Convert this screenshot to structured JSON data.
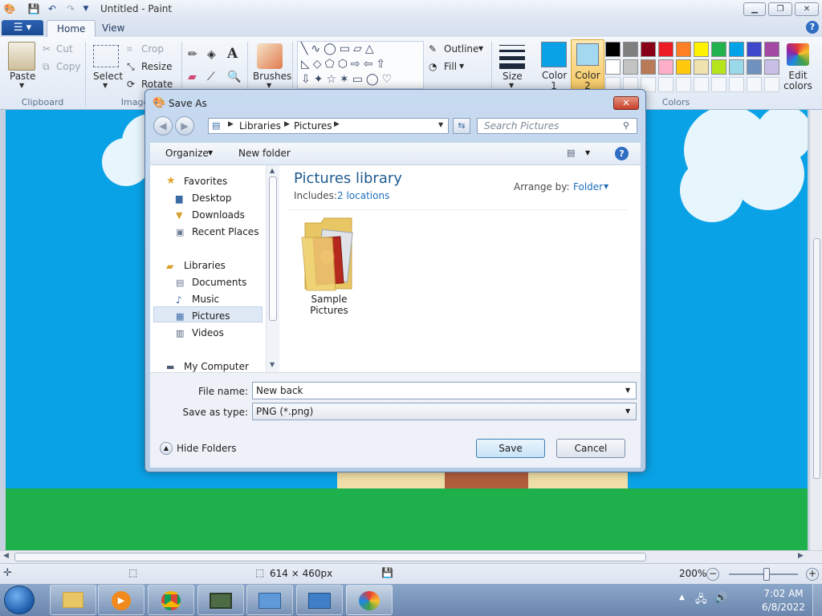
{
  "window": {
    "title": "Untitled - Paint"
  },
  "tabs": [
    {
      "label": "Home"
    },
    {
      "label": "View"
    }
  ],
  "ribbon": {
    "clipboard": {
      "paste": "Paste",
      "cut": "Cut",
      "copy": "Copy",
      "group": "Clipboard"
    },
    "image": {
      "select": "Select",
      "crop": "Crop",
      "resize": "Resize",
      "rotate": "Rotate",
      "group": "Image"
    },
    "tools": {
      "brushes": "Brushes"
    },
    "shapes": {
      "outline": "Outline",
      "fill": "Fill"
    },
    "size": "Size",
    "color1": "Color 1",
    "color2": "Color 2",
    "edit_colors": "Edit colors",
    "colors_group": "Colors",
    "color1_value": "#0aa2e6",
    "color2_value": "#a3d8f0",
    "palette_row1": [
      "#000000",
      "#7f7f7f",
      "#880015",
      "#ed1c24",
      "#ff7f27",
      "#fff200",
      "#22b14c",
      "#00a2e8",
      "#3f48cc",
      "#a349a4"
    ],
    "palette_row2": [
      "#ffffff",
      "#c3c3c3",
      "#b97a57",
      "#ffaec9",
      "#ffc90e",
      "#efe4b0",
      "#b5e61d",
      "#99d9ea",
      "#7092be",
      "#c8bfe7"
    ]
  },
  "dialog": {
    "title": "Save As",
    "breadcrumb": [
      "Libraries",
      "Pictures"
    ],
    "search_placeholder": "Search Pictures",
    "organize": "Organize",
    "new_folder": "New folder",
    "nav": {
      "favorites": "Favorites",
      "favorites_items": [
        "Desktop",
        "Downloads",
        "Recent Places"
      ],
      "libraries": "Libraries",
      "library_items": [
        "Documents",
        "Music",
        "Pictures",
        "Videos"
      ],
      "computer": "My Computer"
    },
    "library_title": "Pictures library",
    "includes_label": "Includes:",
    "includes_link": "2 locations",
    "arrange_by_label": "Arrange by:",
    "arrange_by_value": "Folder",
    "folder_item": "Sample Pictures",
    "file_name_label": "File name:",
    "file_name_value": "New back",
    "save_type_label": "Save as type:",
    "save_type_value": "PNG (*.png)",
    "hide_folders": "Hide Folders",
    "save_button": "Save",
    "cancel_button": "Cancel"
  },
  "status": {
    "dimensions": "614 × 460px",
    "zoom": "200%"
  },
  "clock": {
    "time": "7:02 AM",
    "date": "6/8/2022"
  }
}
